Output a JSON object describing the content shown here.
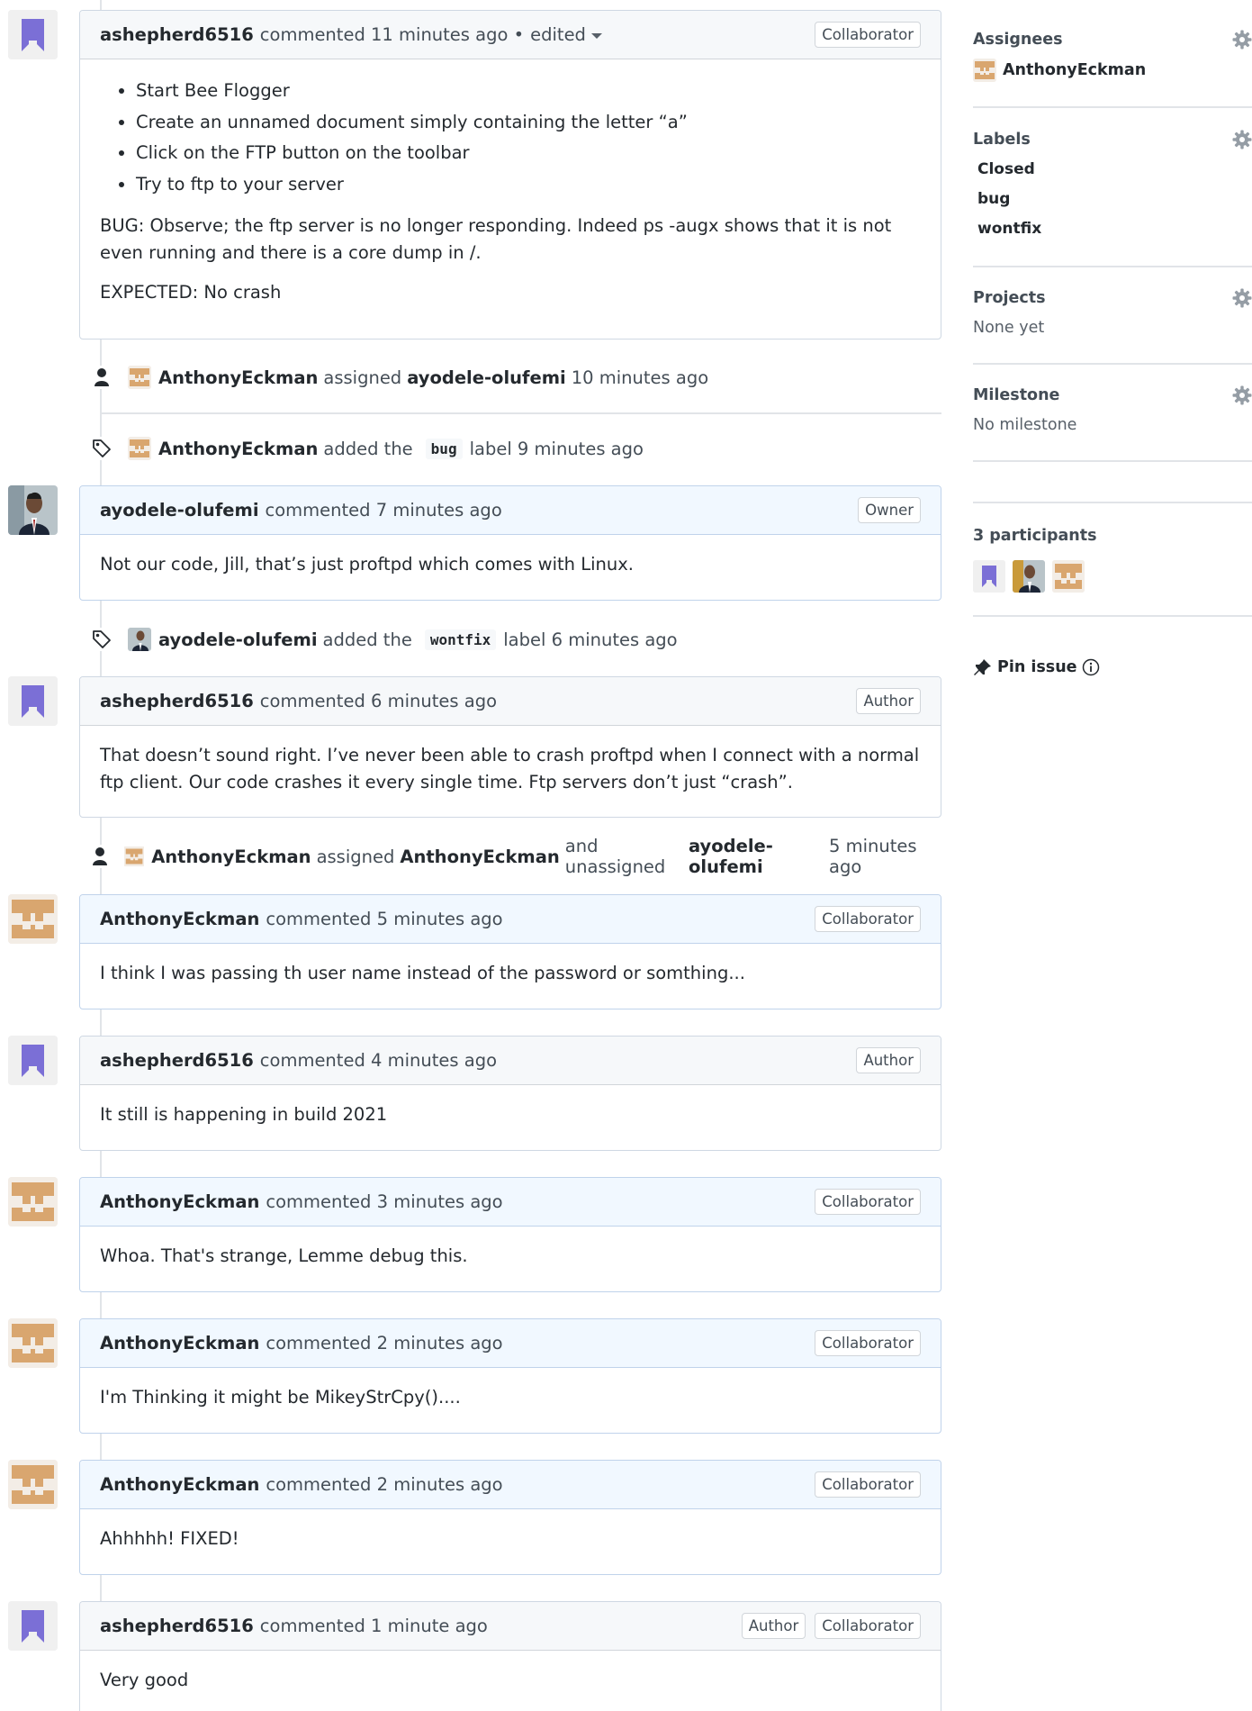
{
  "colors": {
    "purple_avatar": "#7b6fd6",
    "tan_avatar": "#d9a66f",
    "link_text": "#24292e",
    "muted_text": "#586069",
    "border": "#d1d5da",
    "owned_border": "#c0d3eb"
  },
  "timeline": {
    "c1": {
      "author": "ashepherd6516",
      "action": "commented 11 minutes ago •",
      "edited": "edited",
      "badge": "Collaborator",
      "list": [
        "Start Bee Flogger",
        "Create an unnamed document simply containing the letter “a”",
        "Click on the FTP button on the toolbar",
        "Try to ftp to your server"
      ],
      "p1": "BUG: Observe; the ftp server is no longer responding. Indeed ps -augx shows that it is not even running and there is a core dump in /.",
      "p2": "EXPECTED: No crash"
    },
    "e1": {
      "actor": "AnthonyEckman",
      "verb": "assigned",
      "target": "ayodele-olufemi",
      "time": "10 minutes ago"
    },
    "e2": {
      "actor": "AnthonyEckman",
      "verb": "added the",
      "label": "bug",
      "suffix": "label 9 minutes ago"
    },
    "c2": {
      "author": "ayodele-olufemi",
      "action": "commented 7 minutes ago",
      "badge": "Owner",
      "body": "Not our code, Jill, that’s just proftpd which comes with Linux."
    },
    "e3": {
      "actor": "ayodele-olufemi",
      "verb": "added the",
      "label": "wontfix",
      "suffix": "label 6 minutes ago"
    },
    "c3": {
      "author": "ashepherd6516",
      "action": "commented 6 minutes ago",
      "badge": "Author",
      "body": "That doesn’t sound right. I’ve never been able to crash proftpd when I connect with a normal ftp client. Our code crashes it every single time. Ftp servers don’t just “crash”."
    },
    "e4": {
      "actor": "AnthonyEckman",
      "verb": "assigned",
      "target": "AnthonyEckman",
      "conj": "and unassigned",
      "target2": "ayodele-olufemi",
      "time": "5 minutes ago"
    },
    "c4": {
      "author": "AnthonyEckman",
      "action": "commented 5 minutes ago",
      "badge": "Collaborator",
      "body": "I think I was passing th user name instead of the password or somthing..."
    },
    "c5": {
      "author": "ashepherd6516",
      "action": "commented 4 minutes ago",
      "badge": "Author",
      "body": "It still is happening in build 2021"
    },
    "c6": {
      "author": "AnthonyEckman",
      "action": "commented 3 minutes ago",
      "badge": "Collaborator",
      "body": "Whoa. That's strange, Lemme debug this."
    },
    "c7": {
      "author": "AnthonyEckman",
      "action": "commented 2 minutes ago",
      "badge": "Collaborator",
      "body": "I'm Thinking it might be MikeyStrCpy()...."
    },
    "c8": {
      "author": "AnthonyEckman",
      "action": "commented 2 minutes ago",
      "badge": "Collaborator",
      "body": "Ahhhhh! FIXED!"
    },
    "c9": {
      "author": "ashepherd6516",
      "action": "commented 1 minute ago",
      "badge1": "Author",
      "badge2": "Collaborator",
      "body": "Very good"
    }
  },
  "sidebar": {
    "assignees": {
      "heading": "Assignees",
      "user": "AnthonyEckman"
    },
    "labels": {
      "heading": "Labels",
      "items": [
        "Closed",
        "bug",
        "wontfix"
      ]
    },
    "projects": {
      "heading": "Projects",
      "value": "None yet"
    },
    "milestone": {
      "heading": "Milestone",
      "value": "No milestone"
    },
    "participants": {
      "heading": "3 participants"
    },
    "pin": {
      "label": "Pin issue"
    }
  }
}
